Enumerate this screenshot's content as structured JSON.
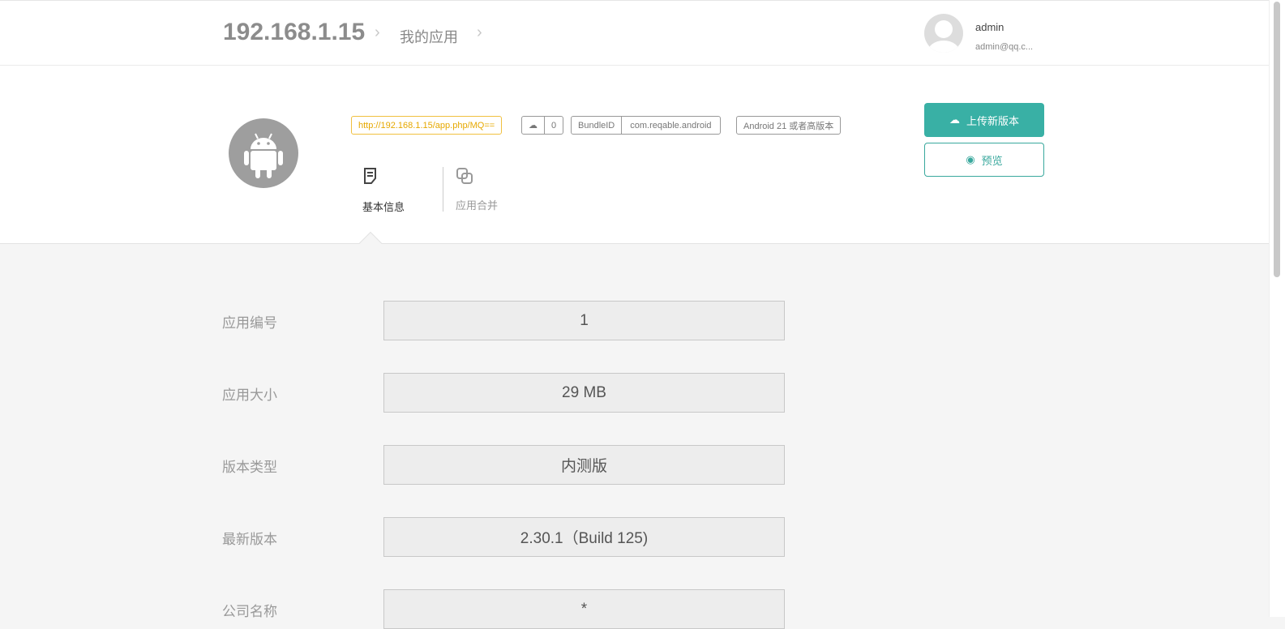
{
  "header": {
    "server": "192.168.1.15",
    "breadcrumb": "我的应用",
    "user": {
      "name": "admin",
      "email": "admin@qq.c..."
    }
  },
  "app": {
    "url": "http://192.168.1.15/app.php/MQ==",
    "download_count": "0",
    "bundle_label": "BundleID",
    "bundle_id": "com.reqable.android",
    "min_os": "Android 21 或者高版本",
    "tabs": [
      {
        "label": "基本信息",
        "active": true
      },
      {
        "label": "应用合并",
        "active": false
      }
    ],
    "upload_label": "上传新版本",
    "preview_label": "预览"
  },
  "colors": {
    "accent": "#39b0a5",
    "url_tag": "#f0b400"
  },
  "fields": [
    {
      "label": "应用编号",
      "value": "1"
    },
    {
      "label": "应用大小",
      "value": "29 MB"
    },
    {
      "label": "版本类型",
      "value": "内测版"
    },
    {
      "label": "最新版本",
      "value": "2.30.1（Build 125)"
    },
    {
      "label": "公司名称",
      "value": "*"
    }
  ]
}
